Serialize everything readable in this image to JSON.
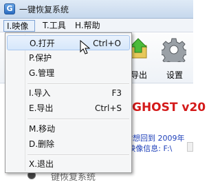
{
  "window": {
    "icon_letter": "G",
    "title": "一键恢复系统"
  },
  "menubar": {
    "items": [
      {
        "label": "I.映像"
      },
      {
        "label": "T.工具"
      },
      {
        "label": "H.帮助"
      }
    ]
  },
  "toolbar": {
    "export_label": "导出",
    "settings_label": "设置"
  },
  "dropdown": {
    "items": [
      {
        "label": "O.打开",
        "shortcut": "Ctrl+O"
      },
      {
        "label": "P.保护",
        "shortcut": ""
      },
      {
        "label": "G.管理",
        "shortcut": ""
      },
      {
        "label": "I.导入",
        "shortcut": "F3"
      },
      {
        "label": "E.导出",
        "shortcut": "Ctrl+S"
      },
      {
        "label": "M.移动",
        "shortcut": ""
      },
      {
        "label": "D.删除",
        "shortcut": ""
      },
      {
        "label": "X.退出",
        "shortcut": ""
      }
    ]
  },
  "main": {
    "ghost_title": "GHOST v20",
    "info_line1": "你想回到 2009年",
    "info_line2": "(映像信息: F:\\",
    "radio_label": "键恢复系统"
  }
}
